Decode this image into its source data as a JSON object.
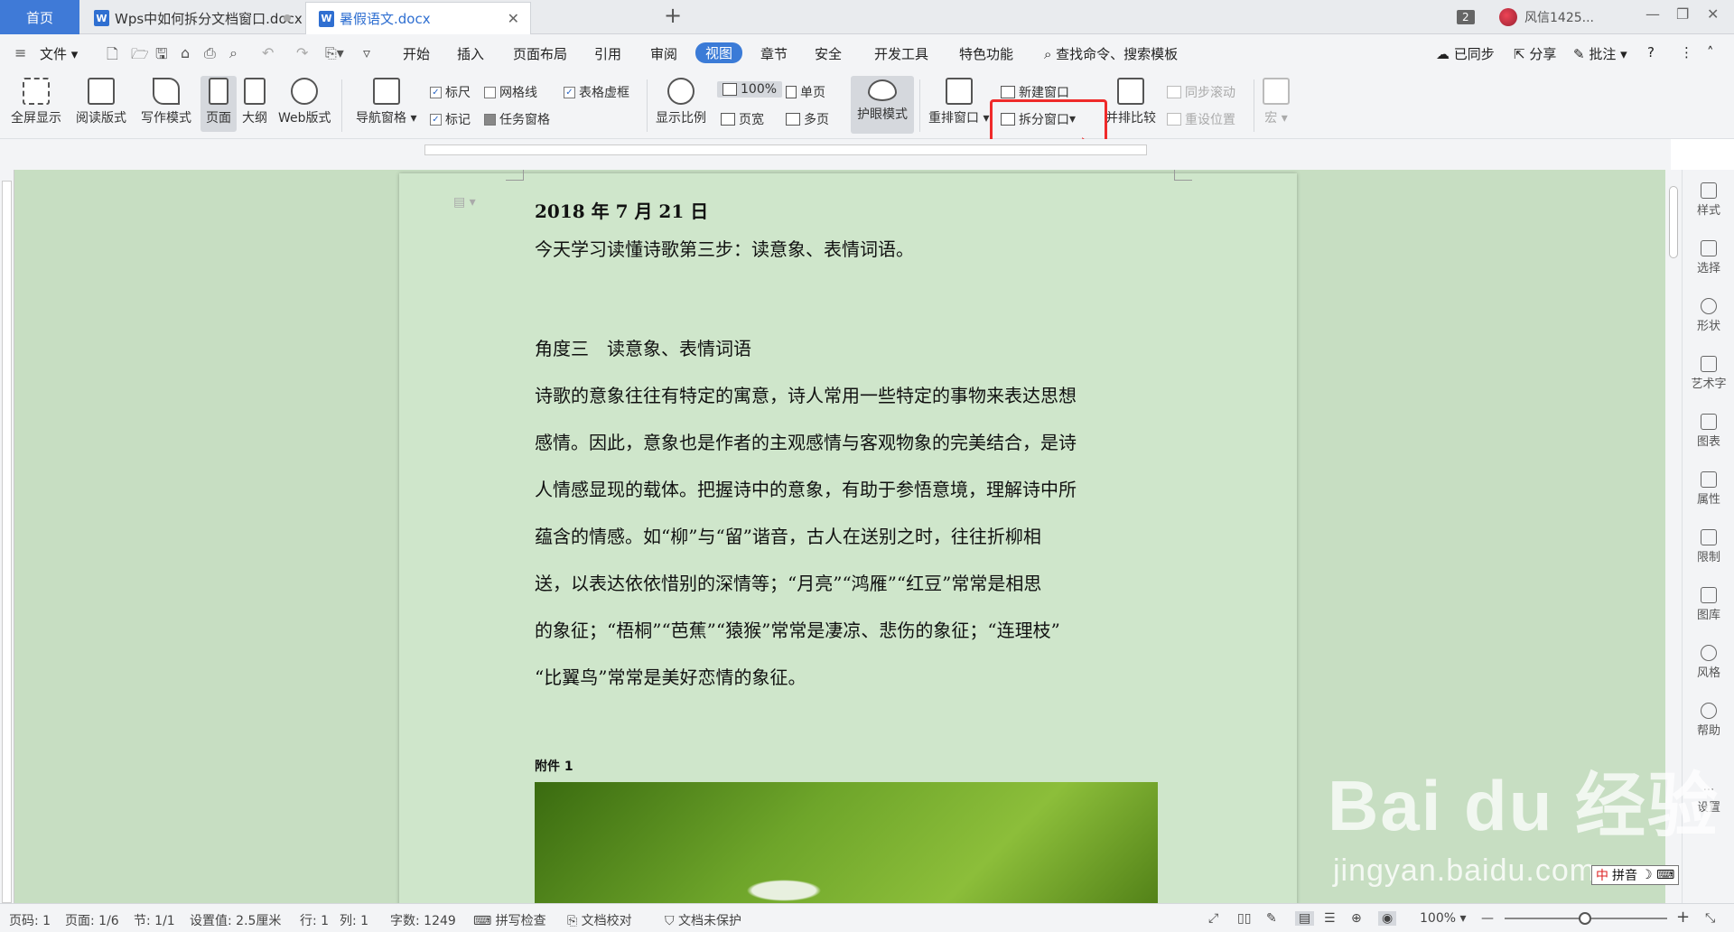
{
  "tabs": {
    "home": "首页",
    "doc1": "Wps中如何拆分文档窗口.docx",
    "doc2": "暑假语文.docx",
    "badge_count": "2",
    "user_name": "风信1425..."
  },
  "menu": {
    "file": "文件",
    "items": [
      "开始",
      "插入",
      "页面布局",
      "引用",
      "审阅",
      "视图",
      "章节",
      "安全",
      "开发工具",
      "特色功能"
    ],
    "active": "视图",
    "search": "查找命令、搜索模板",
    "synced": "已同步",
    "share": "分享",
    "comment": "批注"
  },
  "ribbon": {
    "fullscreen": "全屏显示",
    "read_mode": "阅读版式",
    "write_mode": "写作模式",
    "page": "页面",
    "outline": "大纲",
    "web": "Web版式",
    "nav_pane": "导航窗格",
    "ruler": "标尺",
    "gridlines": "网格线",
    "table_borders": "表格虚框",
    "marks": "标记",
    "task_pane": "任务窗格",
    "zoom_label": "显示比例",
    "zoom_100": "100%",
    "page_width": "页宽",
    "single_page": "单页",
    "multi_page": "多页",
    "eye_mode": "护眼模式",
    "rearrange": "重排窗口",
    "new_window": "新建窗口",
    "split_window": "拆分窗口",
    "side_by_side": "并排比较",
    "sync_scroll": "同步滚动",
    "reset_position": "重设位置",
    "macro": "宏"
  },
  "document": {
    "date": "2018 年 7 月 21 日",
    "intro": "今天学习读懂诗歌第三步：读意象、表情词语。",
    "heading": "角度三　读意象、表情词语",
    "paragraph_lines": [
      "诗歌的意象往往有特定的寓意，诗人常用一些特定的事物来表达思想",
      "感情。因此，意象也是作者的主观感情与客观物象的完美结合，是诗",
      "人情感显现的载体。把握诗中的意象，有助于参悟意境，理解诗中所",
      "蕴含的情感。如“柳”与“留”谐音，古人在送别之时，往往折柳相",
      "送，以表达依依惜别的深情等；“月亮”“鸿雁”“红豆”常常是相思",
      "的象征；“梧桐”“芭蕉”“猿猴”常常是凄凉、悲伤的象征；“连理枝”",
      "“比翼鸟”常常是美好恋情的象征。"
    ],
    "attachment": "附件 1"
  },
  "right_sidebar": [
    "样式",
    "选择",
    "形状",
    "艺术字",
    "图表",
    "属性",
    "限制",
    "图库",
    "风格",
    "帮助",
    "设置"
  ],
  "status": {
    "page_no": "页码: 1",
    "pages": "页面: 1/6",
    "section": "节: 1/1",
    "setting": "设置值: 2.5厘米",
    "row": "行: 1",
    "col": "列: 1",
    "words": "字数: 1249",
    "spell": "拼写检查",
    "proof": "文档校对",
    "protect": "文档未保护",
    "zoom": "100%"
  },
  "ime": "拼音",
  "watermark": {
    "brand": "Bai du 经验",
    "url": "jingyan.baidu.com"
  },
  "colors": {
    "accent": "#3b7bd7",
    "highlight": "#ef2a2a",
    "eye_green": "#c7dec2"
  }
}
